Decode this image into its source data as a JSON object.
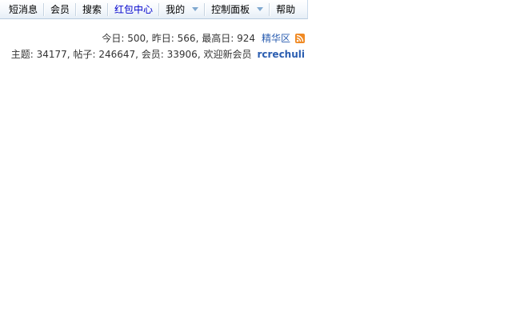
{
  "nav": {
    "items": [
      {
        "label": "短消息"
      },
      {
        "label": "会员"
      },
      {
        "label": "搜索"
      },
      {
        "label": "红包中心"
      },
      {
        "label": "我的"
      },
      {
        "label": "控制面板"
      },
      {
        "label": "帮助"
      }
    ],
    "highlight_color": "#0000cc"
  },
  "stats": {
    "today_label": "今日:",
    "today_value": "500",
    "yesterday_label": "昨日:",
    "yesterday_value": "566",
    "max_label": "最高日:",
    "max_value": "924",
    "digest_link": "精华区",
    "rss_icon": "rss-feed-icon",
    "topics_label": "主题:",
    "topics_value": "34177",
    "posts_label": "帖子:",
    "posts_value": "246647",
    "members_label": "会员:",
    "members_value": "33906",
    "welcome_text": "欢迎新会员",
    "newest_member": "rcrechuli",
    "link_color": "#2a5db0"
  }
}
